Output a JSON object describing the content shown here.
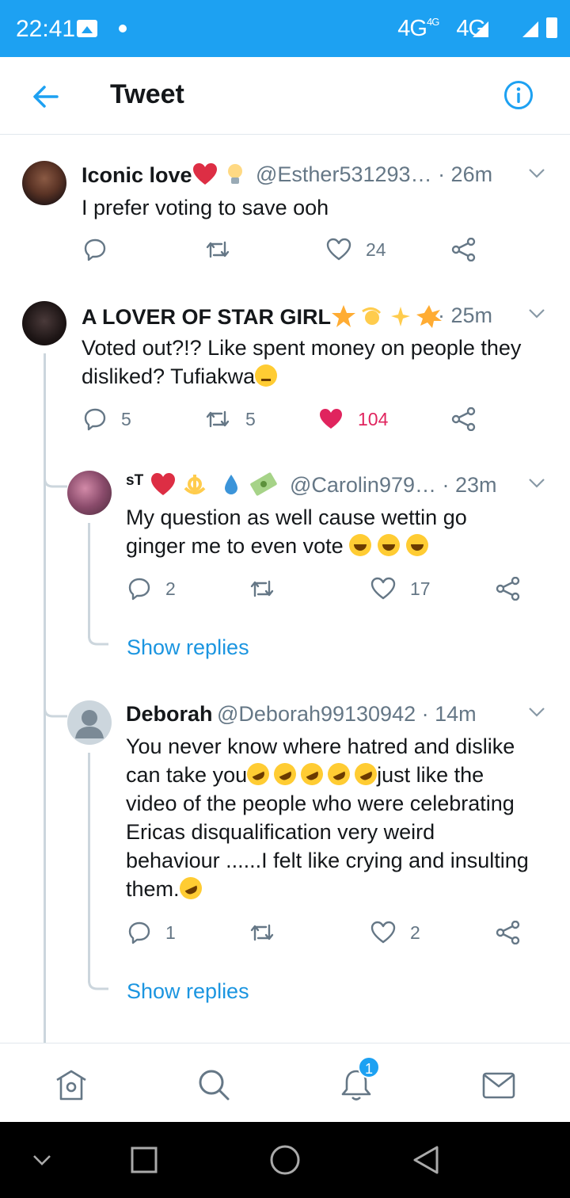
{
  "status_bar": {
    "time": "22:41",
    "network": "4G",
    "network_sup": "4G",
    "network2": "4G"
  },
  "header": {
    "title": "Tweet",
    "back_icon": "arrow-left-icon",
    "info_icon": "info-icon"
  },
  "colors": {
    "accent": "#1da1f2",
    "like_active": "#e0245e",
    "text_secondary": "#657786"
  },
  "tweets": [
    {
      "name": "Iconic love",
      "handle": "@Esther531293…",
      "time": "· 26m",
      "text": "I prefer voting to save ooh",
      "replies": "",
      "retweets": "",
      "likes": "24"
    },
    {
      "name": "A LOVER OF STAR GIRL",
      "handle": "",
      "time": "· 25m",
      "text_line1": "Voted out?!? Like spent money on people they",
      "text_line2": "disliked? Tufiakwa",
      "replies": "5",
      "retweets": "5",
      "likes": "104"
    },
    {
      "name": "sT",
      "handle": "@Carolin979…",
      "time": "· 23m",
      "text_line1": "My question as well cause wettin go",
      "text_line2": "ginger me to even vote",
      "replies": "2",
      "retweets": "",
      "likes": "17",
      "show_replies": "Show replies"
    },
    {
      "name": "Deborah",
      "handle": "@Deborah99130942",
      "time": "· 14m",
      "text_line1": "You never know where hatred and dislike",
      "text_line2a": "can take you",
      "text_line2b": "just like the",
      "text_line3": "video of the people who were celebrating",
      "text_line4": "Ericas disqualification very weird",
      "text_line5": "behaviour ......I felt like crying and insulting",
      "text_line6": "them.",
      "replies": "1",
      "retweets": "",
      "likes": "2",
      "show_replies": "Show replies"
    }
  ],
  "tabbar": {
    "notification_badge": "1"
  }
}
